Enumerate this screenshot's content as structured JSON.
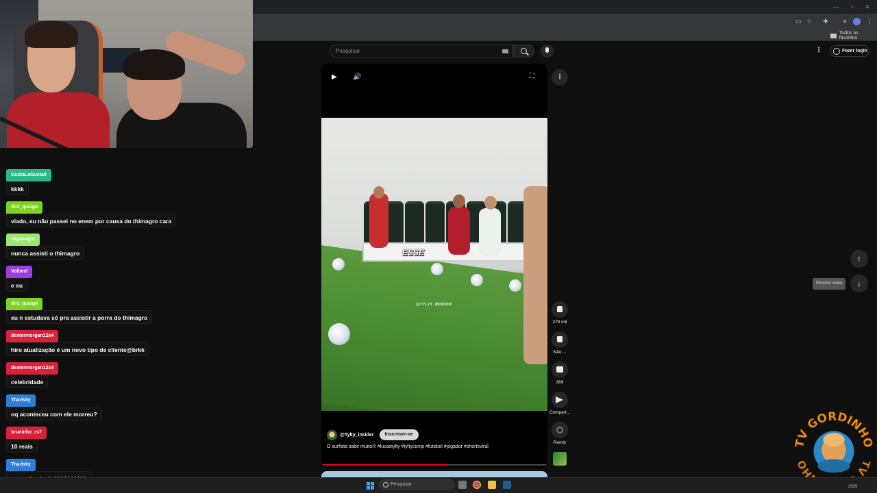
{
  "browser": {
    "bookmarks_all": "Todos os favoritos"
  },
  "youtube": {
    "search_placeholder": "Pesquisar",
    "login_label": "Fazer login",
    "channel_name": "@Tylty_insider",
    "subscribe_label": "Inscrever-se",
    "description": "O surfista sabe muito!!! #lucastylty #tyltycomp #futebol #jogador #shortsviral",
    "video_overlay_text": "ESSE",
    "video_watermark": "@TYLTY_INSIDER",
    "progress_fraction": 0.56,
    "actions": {
      "like_count": "278 mil",
      "dislike_label": "Não ...",
      "comments_count": "369",
      "share_label": "Compart...",
      "remix_label": "Remix"
    },
    "next_video_tooltip": "Próximo vídeo"
  },
  "chat": {
    "messages": [
      {
        "user": "GustaLaGusta8",
        "text": "kkkk",
        "color": "#2bb68c"
      },
      {
        "user": "dirz_quaigo",
        "text": "viado, eu não passei no enem por causa do thimagro cara",
        "color": "#7cd321"
      },
      {
        "user": "vkgaaugm",
        "text": "nunca assisti o thimagro",
        "color": "#9be86e"
      },
      {
        "user": "Volbeel",
        "text": "e eu",
        "color": "#9b3fe0"
      },
      {
        "user": "dirz_quaigo",
        "text": "eu n estudava só pra assistir a porra do thimagro",
        "color": "#7cd321"
      },
      {
        "user": "dextermorgan12x4",
        "text": "hiro atualização é um novo tipo de cliente@brkk",
        "color": "#d8213c"
      },
      {
        "user": "dextermorgan12x4",
        "text": "celebridade",
        "color": "#d8213c"
      },
      {
        "user": "Tharlsky",
        "text": "oq aconteceu com ele morreu?",
        "color": "#2e7ed6"
      },
      {
        "user": "bruninho_rs7",
        "text": "10 reais",
        "color": "#d8213c"
      },
      {
        "user": "Tharlsky",
        "text": "gv me baniu de lá kkkkkkkk",
        "color": "#2e7ed6"
      }
    ]
  },
  "overlay": {
    "logo_text_top": "TV GORDINHO",
    "logo_text_bottom": "TV GORDINHO"
  },
  "taskbar": {
    "search_placeholder": "Pesquisar",
    "clock_date": "2025"
  }
}
